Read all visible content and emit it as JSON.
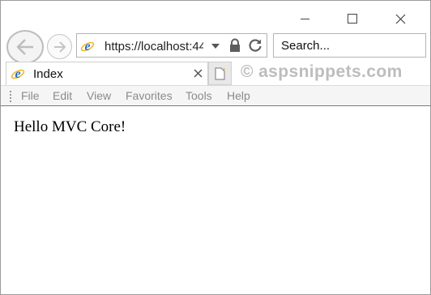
{
  "browser": {
    "address": {
      "url": "https://localhost:44"
    },
    "search": {
      "placeholder": "Search..."
    },
    "tab": {
      "title": "Index"
    },
    "watermark": "© aspsnippets.com",
    "menu": [
      "File",
      "Edit",
      "View",
      "Favorites",
      "Tools",
      "Help"
    ]
  },
  "page": {
    "text": "Hello MVC Core!"
  },
  "icons": {
    "browser_logo": "internet-explorer-icon",
    "back": "back-arrow-icon",
    "forward": "forward-arrow-icon",
    "address_dropdown": "chevron-down-icon",
    "lock": "lock-icon",
    "refresh": "refresh-icon",
    "tab_close": "close-icon",
    "new_tab": "new-tab-icon",
    "minimize": "minimize-icon",
    "maximize": "maximize-icon",
    "window_close": "close-icon"
  },
  "colors": {
    "ie_blue": "#1e73be",
    "ie_ring": "#f2b632",
    "menu_text": "#8a8a8a",
    "watermark": "#bdbdbd"
  }
}
